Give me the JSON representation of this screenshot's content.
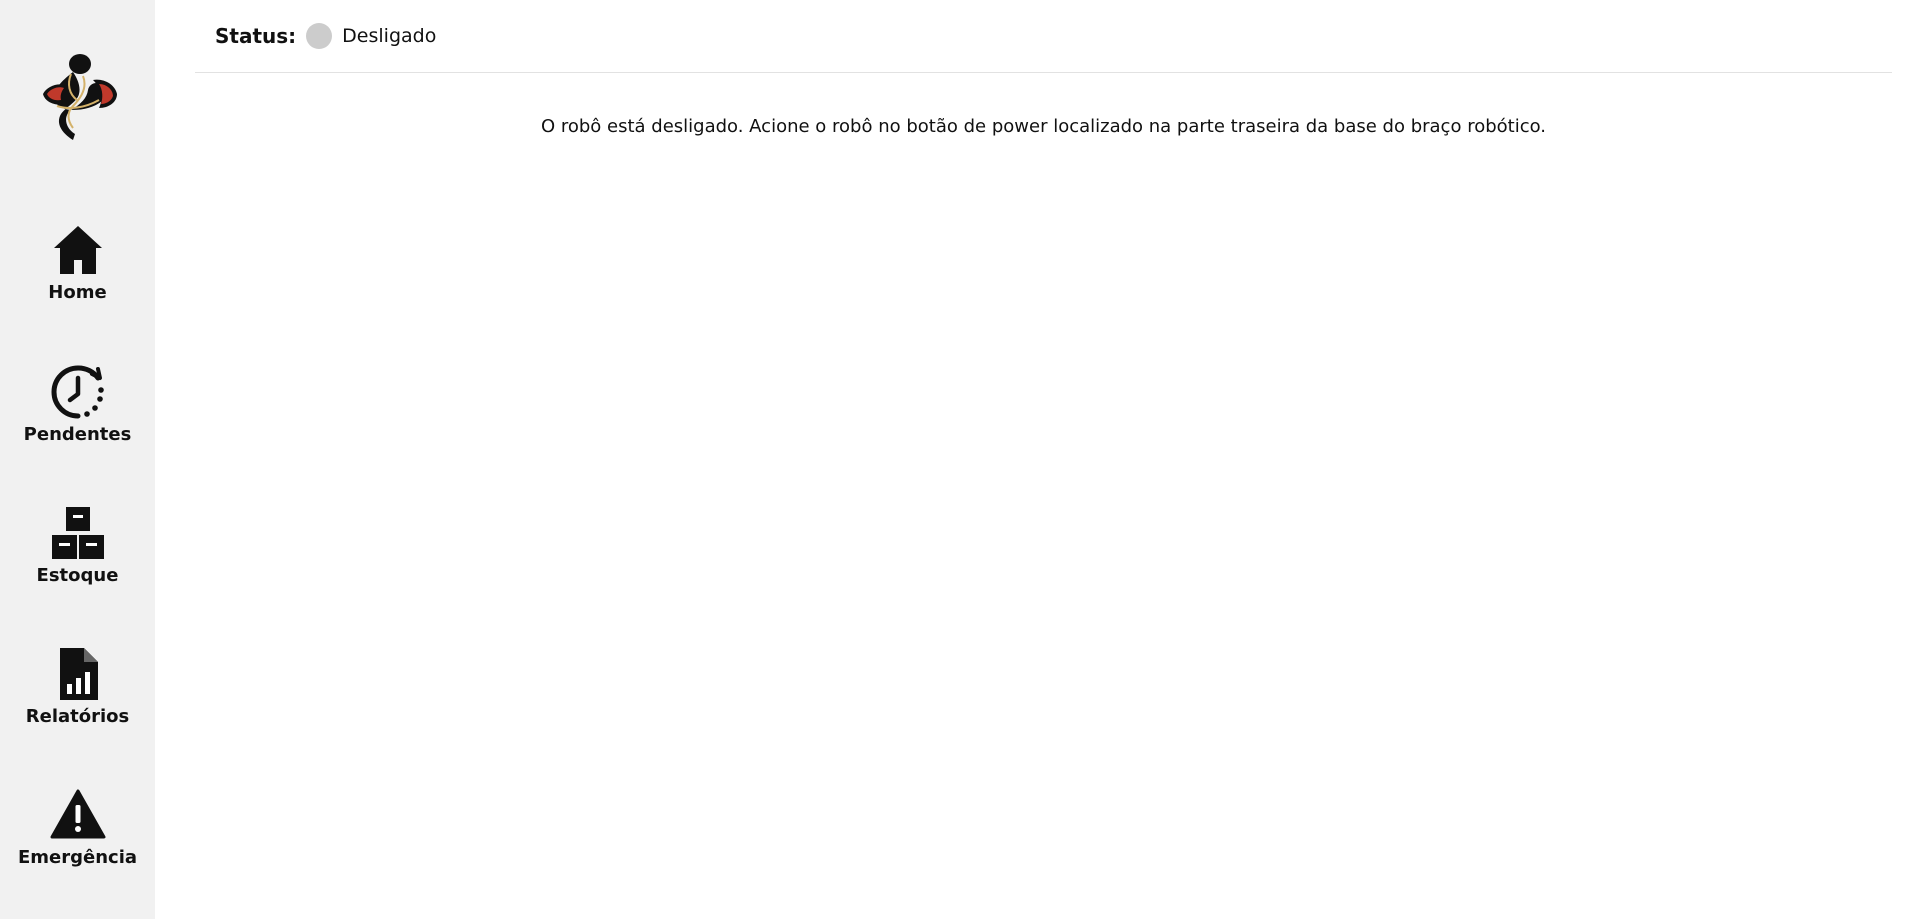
{
  "sidebar": {
    "logo_icon": "snake-arm-logo-icon",
    "items": [
      {
        "label": "Home",
        "icon": "home-icon"
      },
      {
        "label": "Pendentes",
        "icon": "clock-history-icon"
      },
      {
        "label": "Estoque",
        "icon": "boxes-icon"
      },
      {
        "label": "Relatórios",
        "icon": "report-file-icon"
      },
      {
        "label": "Emergência",
        "icon": "warning-triangle-icon"
      }
    ]
  },
  "header": {
    "status_label": "Status:",
    "status_value": "Desligado",
    "status_color": "#cccccc"
  },
  "main": {
    "message": "O robô está desligado. Acione o robô no botão de power localizado na parte traseira da base do braço robótico."
  },
  "colors": {
    "sidebar_bg": "#f1f1f1",
    "logo_accent": "#c0392b",
    "logo_gold": "#d4b26a"
  }
}
